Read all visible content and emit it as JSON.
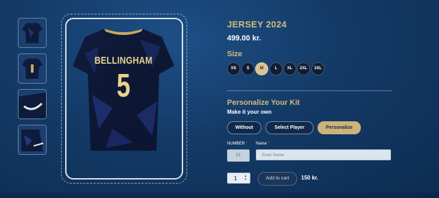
{
  "product": {
    "title": "JERSEY 2024",
    "price": "499.00 kr."
  },
  "jersey_print": {
    "name": "BELLINGHAM",
    "number": "5"
  },
  "thumbnails": [
    {
      "view": "front",
      "icon": "jersey-front-thumb"
    },
    {
      "view": "back",
      "icon": "jersey-back-thumb"
    },
    {
      "view": "collar",
      "icon": "collar-detail-thumb"
    },
    {
      "view": "fabric",
      "icon": "fabric-detail-thumb"
    }
  ],
  "size": {
    "label": "Size",
    "options": [
      "XS",
      "S",
      "M",
      "L",
      "XL",
      "2XL",
      "3XL"
    ],
    "selected": "M"
  },
  "personalize": {
    "title": "Personalize Your Kit",
    "subtitle": "Make it your own",
    "options": [
      "Without",
      "Select Player",
      "Personalize"
    ],
    "active": "Personalize",
    "number_label": "NUMBER",
    "name_label": "Name",
    "required_mark": "*",
    "number_value": "01",
    "name_placeholder": "Enter Name"
  },
  "cart": {
    "quantity": "1",
    "add_label": "Add to cart",
    "extra_price": "150 kr."
  },
  "colors": {
    "accent_gold": "#d5b97a",
    "background": "#133a66",
    "jersey_navy": "#0f1b3a"
  }
}
